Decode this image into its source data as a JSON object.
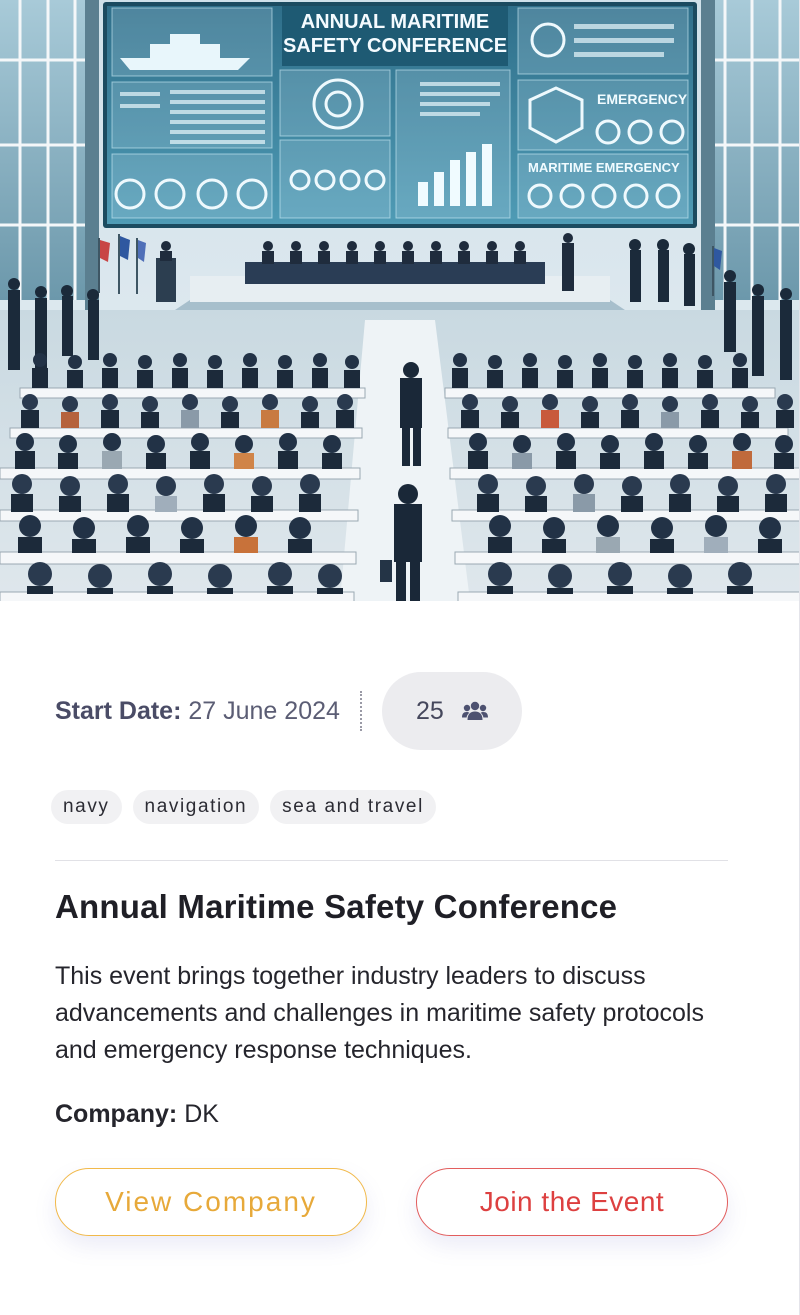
{
  "event": {
    "hero_banner_line1": "ANNUAL MARITIME",
    "hero_banner_line2": "SAFETY CONFERENCE",
    "hero_screen_emergency": "EMERGENCY",
    "hero_screen_maritime": "MARITIME EMERGENCY",
    "start_date_label": "Start Date:",
    "start_date_value": "27 June 2024",
    "attendee_count": "25",
    "attendee_icon": "users-icon",
    "tags": [
      "navy",
      "navigation",
      "sea and travel"
    ],
    "title": "Annual Maritime Safety Conference",
    "description": "This event brings together industry leaders to discuss advancements and challenges in maritime safety protocols and emergency response techniques.",
    "company_label": "Company:",
    "company_value": "DK"
  },
  "actions": {
    "view_company": "View Company",
    "join_event": "Join the Event"
  },
  "colors": {
    "view_company_accent": "#e7a93a",
    "join_event_accent": "#dd4040",
    "label_text": "#4a4c66",
    "pill_background": "#ececef"
  }
}
